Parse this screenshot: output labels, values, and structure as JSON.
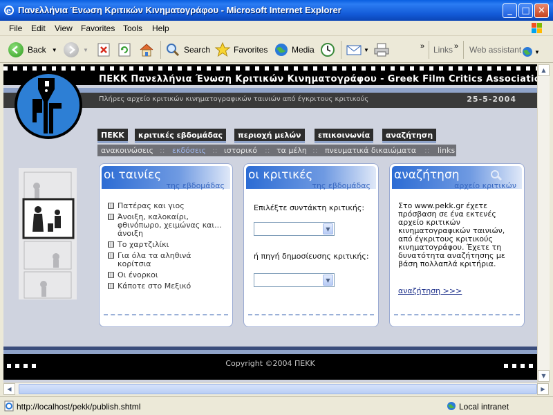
{
  "window": {
    "title": "Πανελλήνια Ένωση Κριτικών Κινηματογράφου - Microsoft Internet Explorer",
    "minimize": "_",
    "maximize": "□",
    "close": "✕"
  },
  "menu": [
    "File",
    "Edit",
    "View",
    "Favorites",
    "Tools",
    "Help"
  ],
  "toolbar": {
    "back": "Back",
    "search": "Search",
    "favorites": "Favorites",
    "media": "Media",
    "links": "Links",
    "web_assistant": "Web assistant",
    "chevron": "»"
  },
  "site": {
    "header_title": "ΠΕΚΚ Πανελλήνια Ένωση Κριτικών Κινηματογράφου - Greek Film Critics Association",
    "tagline": "Πλήρες αρχείο κριτικών κινηματογραφικών ταινιών από έγκριτους κριτικούς",
    "date": "25-5-2004",
    "nav": [
      "ΠΕΚΚ",
      "κριτικές εβδομάδας",
      "περιοχή μελών",
      "επικοινωνία",
      "αναζήτηση"
    ],
    "subnav": [
      "ανακοινώσεις",
      "εκδόσεις",
      "ιστορικό",
      "τα μέλη",
      "πνευματικά δικαιώματα",
      "links"
    ],
    "subnav_sep": "::",
    "films_box": {
      "title": "οι ταινίες",
      "subtitle": "της εβδομάδας",
      "items": [
        "Πατέρας και γιος",
        "Άνοιξη, καλοκαίρι, φθινόπωρο, χειμώνας και... άνοιξη",
        "Το χαρτζιλίκι",
        "Για όλα τα αληθινά κορίτσια",
        "Οι ένορκοι",
        "Κάποτε στο Μεξικό"
      ]
    },
    "critics_box": {
      "title": "οι κριτικές",
      "subtitle": "της εβδομάδας",
      "label_author": "Επιλέξτε συντάκτη κριτικής:",
      "label_source": "ή πηγή δημοσίευσης κριτικής:",
      "author_value": "",
      "source_value": ""
    },
    "search_box": {
      "title": "αναζήτηση",
      "subtitle": "αρχείο κριτικών",
      "text": "Στο www.pekk.gr έχετε πρόσβαση σε ένα εκτενές αρχείο κριτικών κινηματογραφικών ταινιών, από έγκριτους κριτικούς κινηματογράφου. Έχετε τη δυνατότητα αναζήτησης με βάση πολλαπλά κριτήρια.",
      "link": "αναζήτηση >>>"
    },
    "copyright": "Copyright ©2004 ΠΕΚΚ"
  },
  "status": {
    "url": "http://localhost/pekk/publish.shtml",
    "zone": "Local intranet"
  },
  "colors": {
    "titlebar": "#0a5fe0",
    "box_head": "#2c6cd4",
    "page_bg": "#cfd3df"
  }
}
